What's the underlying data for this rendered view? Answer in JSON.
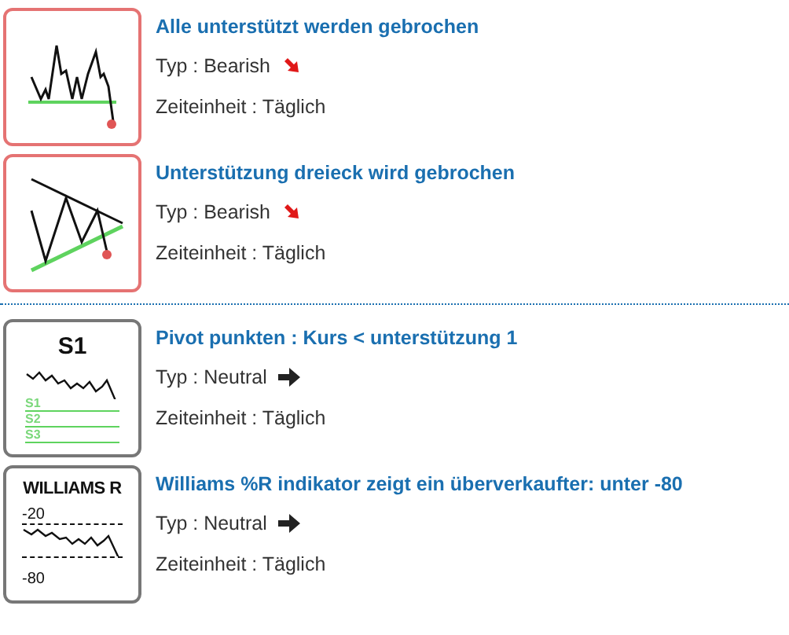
{
  "groups": [
    {
      "items": [
        {
          "kind": "support-break",
          "title": "Alle unterstützt werden gebrochen",
          "type": "Typ : Bearish",
          "bearish": true,
          "timeframe": "Zeiteinheit : Täglich"
        },
        {
          "kind": "triangle",
          "title": "Unterstützung dreieck wird gebrochen",
          "type": "Typ : Bearish",
          "bearish": true,
          "timeframe": "Zeiteinheit : Täglich"
        }
      ]
    },
    {
      "items": [
        {
          "kind": "pivot",
          "heading": "S1",
          "levels": [
            "S1",
            "S2",
            "S3"
          ],
          "title": "Pivot punkten : Kurs < unterstützung 1",
          "type": "Typ : Neutral",
          "bearish": false,
          "timeframe": "Zeiteinheit : Täglich"
        },
        {
          "kind": "williams",
          "heading": "WILLIAMS R",
          "levels": [
            "-20",
            "-80"
          ],
          "title": "Williams %R indikator zeigt ein überverkaufter: unter -80",
          "type": "Typ : Neutral",
          "bearish": false,
          "timeframe": "Zeiteinheit : Täglich"
        }
      ]
    }
  ]
}
